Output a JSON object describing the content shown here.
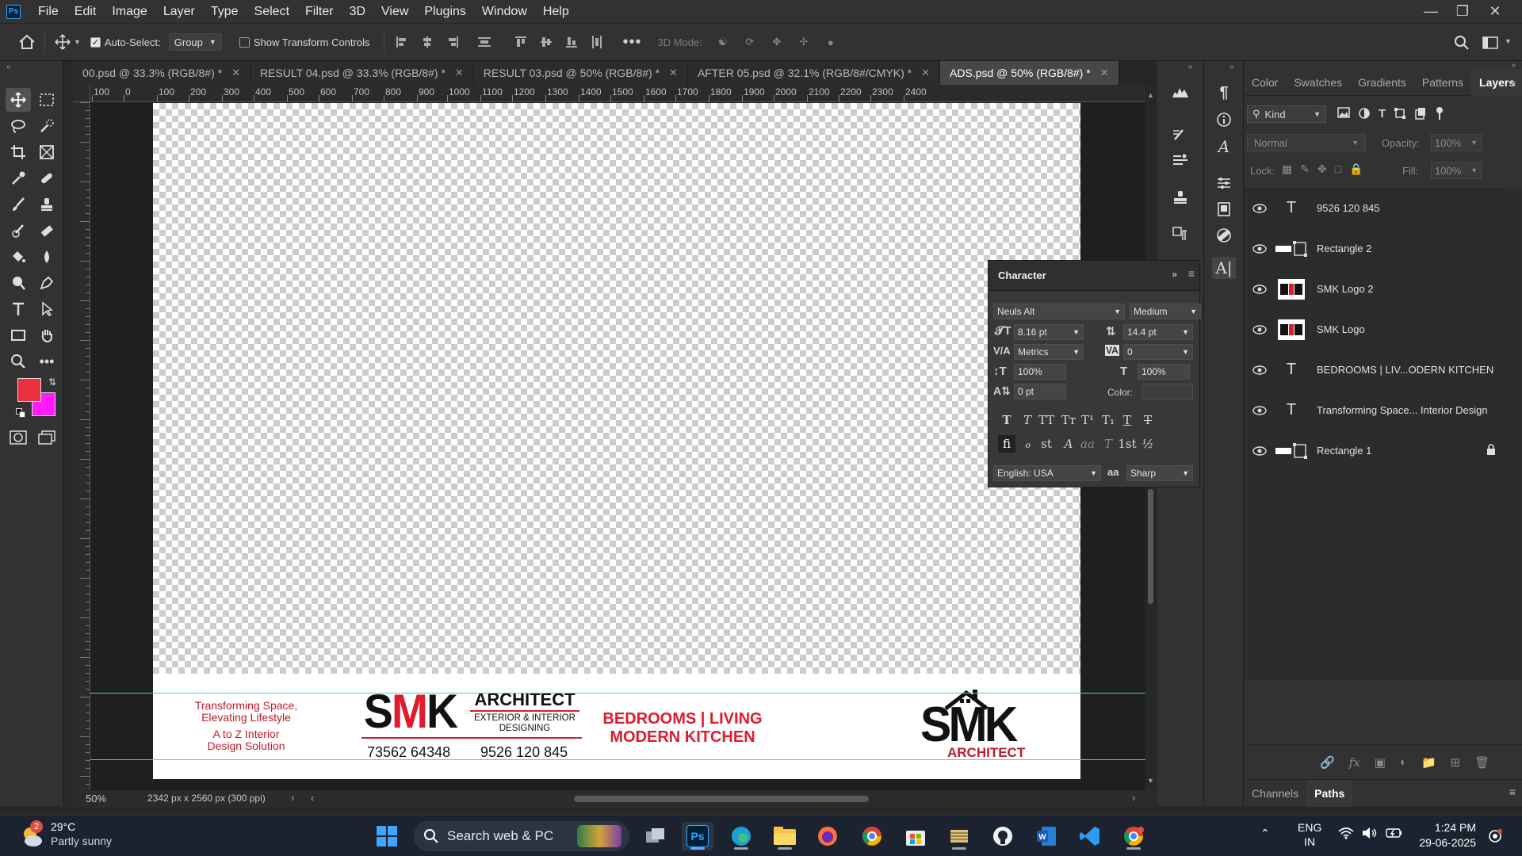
{
  "app": {
    "logo_text": "Ps",
    "menus": [
      "File",
      "Edit",
      "Image",
      "Layer",
      "Type",
      "Select",
      "Filter",
      "3D",
      "View",
      "Plugins",
      "Window",
      "Help"
    ]
  },
  "options_bar": {
    "auto_select_label": "Auto-Select:",
    "auto_select_checked": true,
    "auto_select_value": "Group",
    "transform_controls_label": "Show Transform Controls",
    "transform_controls_checked": false,
    "mode_3d_label": "3D Mode:"
  },
  "tabs": [
    {
      "label": "00.psd @ 33.3% (RGB/8#) *",
      "active": false
    },
    {
      "label": "RESULT 04.psd @ 33.3% (RGB/8#) *",
      "active": false
    },
    {
      "label": "RESULT 03.psd @ 50% (RGB/8#) *",
      "active": false
    },
    {
      "label": "AFTER 05.psd @ 32.1% (RGB/8#/CMYK) *",
      "active": false
    },
    {
      "label": "ADS.psd @ 50% (RGB/8#) *",
      "active": true
    }
  ],
  "ruler_top": [
    "100",
    "0",
    "100",
    "200",
    "300",
    "400",
    "500",
    "600",
    "700",
    "800",
    "900",
    "1000",
    "1100",
    "1200",
    "1300",
    "1400",
    "1500",
    "1600",
    "1700",
    "1800",
    "1900",
    "2000",
    "2100",
    "2200",
    "2300",
    "2400"
  ],
  "colors": {
    "foreground": "#e8313c",
    "background": "#ff1aff",
    "guide": "#30d7e8",
    "brand_red": "#e01b2e",
    "brand_dark_red": "#c0192b"
  },
  "banner": {
    "tagline_line1": "Transforming Space,",
    "tagline_line2": "Elevating Lifestyle",
    "tagline_line3": "A to Z Interior",
    "tagline_line4": "Design Solution",
    "logo_letters": "SMK",
    "architect_title": "ARCHITECT",
    "architect_sub1": "EXTERIOR & INTERIOR",
    "architect_sub2": "DESIGNING",
    "phone1": "73562 64348",
    "phone2": "9526 120 845",
    "rooms_line1": "BEDROOMS | LIVING",
    "rooms_line2": "MODERN KITCHEN",
    "logo2_letters": "SMK",
    "logo2_sub": "ARCHITECT"
  },
  "status": {
    "zoom": "50%",
    "doc_info": "2342 px x 2560 px (300 ppi)"
  },
  "character_panel": {
    "title": "Character",
    "font_family": "Neuls Alt",
    "font_style": "Medium",
    "size": "8.16 pt",
    "leading": "14.4 pt",
    "kerning": "Metrics",
    "tracking": "0",
    "vertical_scale": "100%",
    "horizontal_scale": "100%",
    "baseline_shift": "0 pt",
    "color_label": "Color:",
    "language": "English: USA",
    "antialias_icon": "aa",
    "antialias": "Sharp",
    "style_buttons": [
      "T",
      "T",
      "TT",
      "Tт",
      "T¹",
      "T₁",
      "T",
      "T"
    ],
    "opentype_buttons": [
      "fi",
      "ℴ",
      "st",
      "A",
      "aa",
      "T",
      "1st",
      "½"
    ]
  },
  "right_panel": {
    "tabs": [
      "Color",
      "Swatches",
      "Gradients",
      "Patterns",
      "Layers"
    ],
    "active_tab": "Layers",
    "kind_label": "Kind",
    "blend_mode": "Normal",
    "opacity_label": "Opacity:",
    "opacity": "100%",
    "lock_label": "Lock:",
    "fill_label": "Fill:",
    "fill": "100%",
    "layers": [
      {
        "name": "9526 120 845",
        "kind": "text"
      },
      {
        "name": "Rectangle 2",
        "kind": "shape"
      },
      {
        "name": "SMK Logo 2",
        "kind": "smart"
      },
      {
        "name": "SMK Logo",
        "kind": "smart"
      },
      {
        "name": "BEDROOMS | LIV...ODERN KITCHEN",
        "kind": "text"
      },
      {
        "name": "Transforming Space... Interior Design",
        "kind": "text"
      },
      {
        "name": "Rectangle 1",
        "kind": "shape",
        "locked": true
      }
    ],
    "bottom_tabs": [
      "Channels",
      "Paths"
    ],
    "bottom_active": "Paths"
  },
  "taskbar": {
    "weather_temp": "29°C",
    "weather_desc": "Partly sunny",
    "weather_badge": "2",
    "search_placeholder": "Search web & PC",
    "lang_line1": "ENG",
    "lang_line2": "IN",
    "time": "1:24 PM",
    "date": "29-06-2025"
  }
}
